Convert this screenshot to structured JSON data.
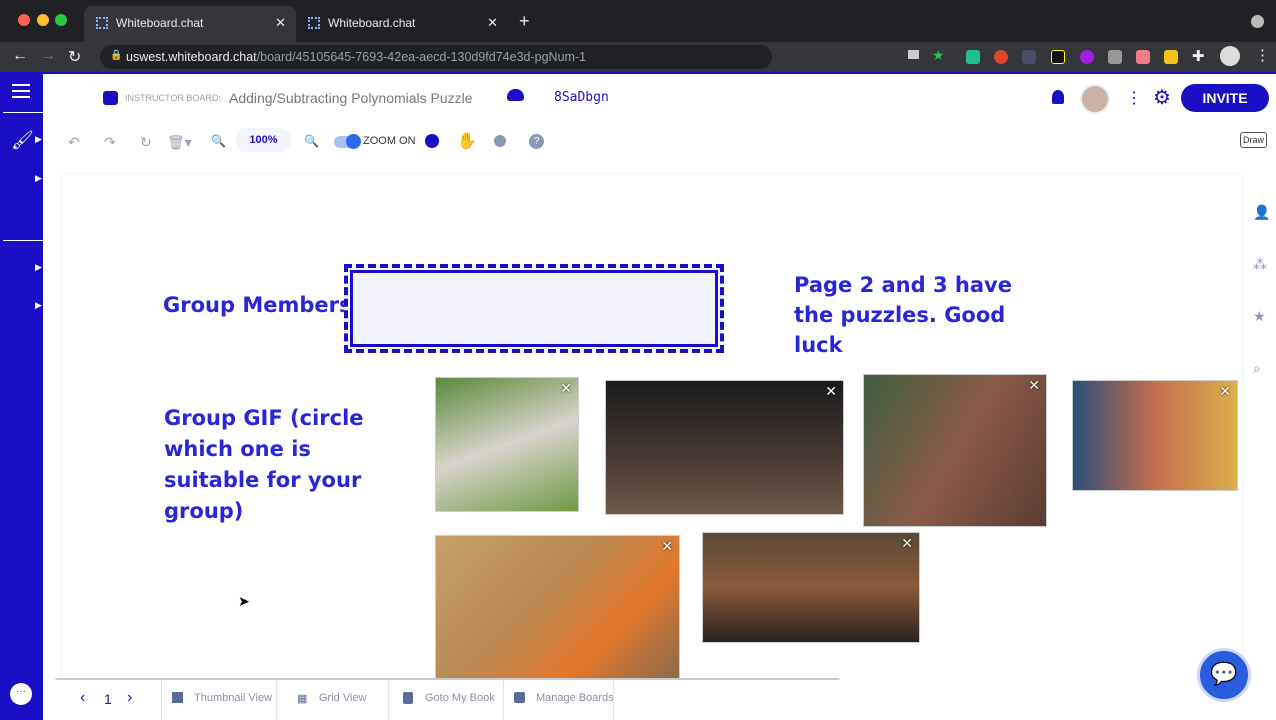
{
  "browser": {
    "tabs": [
      {
        "title": "Whiteboard.chat",
        "active": true
      },
      {
        "title": "Whiteboard.chat",
        "active": false
      }
    ],
    "url_host": "uswest.whiteboard.chat",
    "url_path": "/board/45105645-7693-42ea-aecd-130d9fd74e3d-pgNum-1"
  },
  "header": {
    "board_type": "INSTRUCTOR BOARD:",
    "board_title": "Adding/Subtracting Polynomials Puzzle",
    "board_code": "8SaDbgn",
    "invite_label": "INVITE"
  },
  "toolbar": {
    "zoom_level": "100%",
    "zoom_toggle_label": "ZOOM ON",
    "zoom_on": true,
    "draw_label": "Draw"
  },
  "canvas": {
    "group_members_label": "Group Members:",
    "note": "Page 2 and 3 have the puzzles. Good luck",
    "gif_prompt": "Group GIF (circle which one is suitable for your group)"
  },
  "footer": {
    "page": "1",
    "thumbnail": "Thumbnail View",
    "grid": "Grid View",
    "book": "Goto My Book",
    "manage": "Manage Boards"
  },
  "colors": {
    "accent": "#1a0fc4",
    "text_blue": "#2727d8"
  }
}
